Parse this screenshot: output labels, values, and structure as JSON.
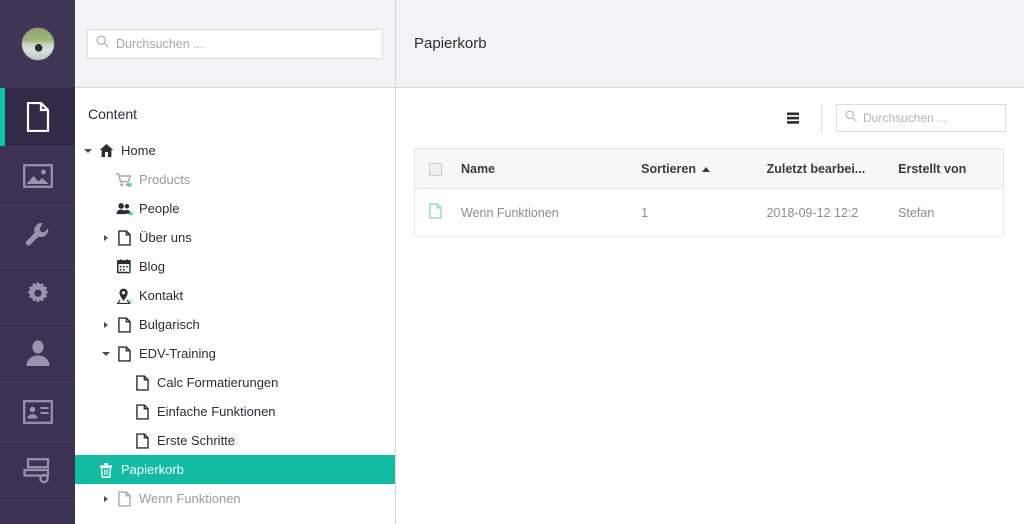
{
  "rail": {
    "avatar": {
      "name": "user-avatar"
    },
    "items": [
      {
        "icon": "content-document-icon",
        "name": "rail-item-content",
        "active": true
      },
      {
        "icon": "media-image-icon",
        "name": "rail-item-media",
        "active": false
      },
      {
        "icon": "settings-wrench-icon",
        "name": "rail-item-settings",
        "active": false
      },
      {
        "icon": "developer-gear-icon",
        "name": "rail-item-developer",
        "active": false
      },
      {
        "icon": "users-person-icon",
        "name": "rail-item-users",
        "active": false
      },
      {
        "icon": "members-idcard-icon",
        "name": "rail-item-members",
        "active": false
      },
      {
        "icon": "forms-layout-icon",
        "name": "rail-item-forms",
        "active": false
      }
    ]
  },
  "tree_search": {
    "placeholder": "Durchsuchen ...",
    "value": ""
  },
  "tree": {
    "title": "Content",
    "items": [
      {
        "label": "Home",
        "icon": "home-icon",
        "indent": 1,
        "caret": "open",
        "muted": false,
        "selected": false
      },
      {
        "label": "Products",
        "icon": "cart-icon",
        "indent": 2,
        "caret": "none",
        "muted": true,
        "selected": false
      },
      {
        "label": "People",
        "icon": "people-icon",
        "indent": 2,
        "caret": "none",
        "muted": false,
        "selected": false
      },
      {
        "label": "Über uns",
        "icon": "document-icon",
        "indent": 2,
        "caret": "collapsed",
        "muted": false,
        "selected": false
      },
      {
        "label": "Blog",
        "icon": "calendar-icon",
        "indent": 2,
        "caret": "none",
        "muted": false,
        "selected": false
      },
      {
        "label": "Kontakt",
        "icon": "mappin-icon",
        "indent": 2,
        "caret": "none",
        "muted": false,
        "selected": false
      },
      {
        "label": "Bulgarisch",
        "icon": "document-icon",
        "indent": 2,
        "caret": "collapsed",
        "muted": false,
        "selected": false
      },
      {
        "label": "EDV-Training",
        "icon": "document-icon",
        "indent": 2,
        "caret": "open",
        "muted": false,
        "selected": false
      },
      {
        "label": "Calc Formatierungen",
        "icon": "document-icon",
        "indent": 3,
        "caret": "none",
        "muted": false,
        "selected": false
      },
      {
        "label": "Einfache Funktionen",
        "icon": "document-icon",
        "indent": 3,
        "caret": "none",
        "muted": false,
        "selected": false
      },
      {
        "label": "Erste Schritte",
        "icon": "document-icon",
        "indent": 3,
        "caret": "none",
        "muted": false,
        "selected": false
      },
      {
        "label": "Papierkorb",
        "icon": "trash-icon",
        "indent": 1,
        "caret": "none",
        "muted": false,
        "selected": true
      },
      {
        "label": "Wenn Funktionen",
        "icon": "document-icon",
        "indent": 2,
        "caret": "collapsed",
        "muted": true,
        "selected": false
      }
    ]
  },
  "main": {
    "title": "Papierkorb",
    "toolbar": {
      "view_toggle_icon": "list-view-icon",
      "search_placeholder": "Durchsuchen ...",
      "search_value": ""
    },
    "table": {
      "columns": [
        {
          "label": "",
          "key": "check"
        },
        {
          "label": "Name",
          "key": "name"
        },
        {
          "label": "Sortieren",
          "key": "sort",
          "sorted": "asc"
        },
        {
          "label": "Zuletzt bearbei...",
          "key": "edited"
        },
        {
          "label": "Erstellt von",
          "key": "createdby"
        }
      ],
      "rows": [
        {
          "icon": "document-icon",
          "name": "Wenn Funktionen",
          "sort": "1",
          "edited": "2018-09-12 12:2",
          "createdby": "Stefan"
        }
      ]
    }
  },
  "colors": {
    "accent_teal": "#11bca2",
    "rail_purple": "#3d3254",
    "rail_active": "#342a48",
    "header_gray": "#f3f3f5"
  }
}
